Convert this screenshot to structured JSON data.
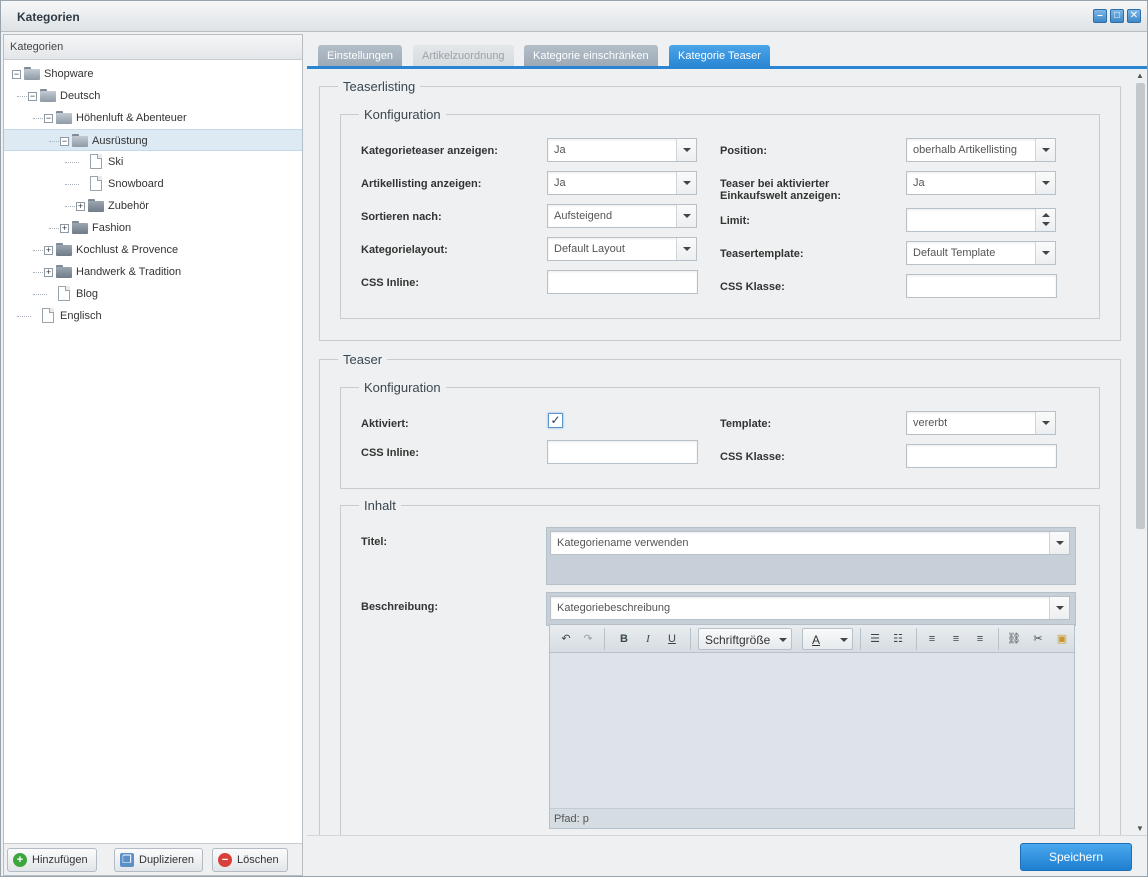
{
  "window": {
    "title": "Kategorien",
    "buttons": [
      "minimize-icon",
      "maximize-icon",
      "close-icon"
    ]
  },
  "tree": {
    "header": "Kategorien",
    "items": [
      {
        "label": "Shopware",
        "level": 0,
        "type": "folder",
        "expanded": true
      },
      {
        "label": "Deutsch",
        "level": 1,
        "type": "folder",
        "expanded": true
      },
      {
        "label": "Höhenluft & Abenteuer",
        "level": 2,
        "type": "folder",
        "expanded": true
      },
      {
        "label": "Ausrüstung",
        "level": 3,
        "type": "folder",
        "expanded": true,
        "selected": true
      },
      {
        "label": "Ski",
        "level": 4,
        "type": "leaf"
      },
      {
        "label": "Snowboard",
        "level": 4,
        "type": "leaf"
      },
      {
        "label": "Zubehör",
        "level": 4,
        "type": "folder",
        "expanded": false
      },
      {
        "label": "Fashion",
        "level": 3,
        "type": "folder",
        "expanded": false
      },
      {
        "label": "Kochlust & Provence",
        "level": 2,
        "type": "folder",
        "expanded": false
      },
      {
        "label": "Handwerk & Tradition",
        "level": 2,
        "type": "folder",
        "expanded": false
      },
      {
        "label": "Blog",
        "level": 2,
        "type": "leaf"
      },
      {
        "label": "Englisch",
        "level": 1,
        "type": "leaf"
      }
    ],
    "buttons": {
      "add": "Hinzufügen",
      "duplicate": "Duplizieren",
      "delete": "Löschen"
    }
  },
  "tabs": [
    {
      "label": "Einstellungen",
      "state": "normal"
    },
    {
      "label": "Artikelzuordnung",
      "state": "disabled"
    },
    {
      "label": "Kategorie einschränken",
      "state": "normal"
    },
    {
      "label": "Kategorie Teaser",
      "state": "active"
    }
  ],
  "teaserlisting": {
    "legend": "Teaserlisting",
    "config_legend": "Konfiguration",
    "fields": {
      "show_teaser_label": "Kategorieteaser anzeigen:",
      "show_teaser_value": "Ja",
      "show_listing_label": "Artikellisting anzeigen:",
      "show_listing_value": "Ja",
      "sort_label": "Sortieren nach:",
      "sort_value": "Aufsteigend",
      "layout_label": "Kategorielayout:",
      "layout_value": "Default Layout",
      "css_inline_label": "CSS Inline:",
      "css_inline_value": "",
      "position_label": "Position:",
      "position_value": "oberhalb Artikellisting",
      "teaser_shopping_label": "Teaser bei aktivierter Einkaufswelt anzeigen:",
      "teaser_shopping_value": "Ja",
      "limit_label": "Limit:",
      "limit_value": "",
      "template_label": "Teasertemplate:",
      "template_value": "Default Template",
      "css_class_label": "CSS Klasse:",
      "css_class_value": ""
    }
  },
  "teaser": {
    "legend": "Teaser",
    "config_legend": "Konfiguration",
    "fields": {
      "active_label": "Aktiviert:",
      "active_checked": true,
      "css_inline_label": "CSS Inline:",
      "template_label": "Template:",
      "template_value": "vererbt",
      "css_class_label": "CSS Klasse:"
    },
    "content_legend": "Inhalt",
    "title_label": "Titel:",
    "title_value": "Kategoriename verwenden",
    "description_label": "Beschreibung:",
    "description_value": "Kategoriebeschreibung",
    "editor": {
      "font_size_placeholder": "Schriftgröße",
      "font_color_glyph": "A",
      "status": "Pfad: p"
    }
  },
  "footer": {
    "save": "Speichern"
  }
}
